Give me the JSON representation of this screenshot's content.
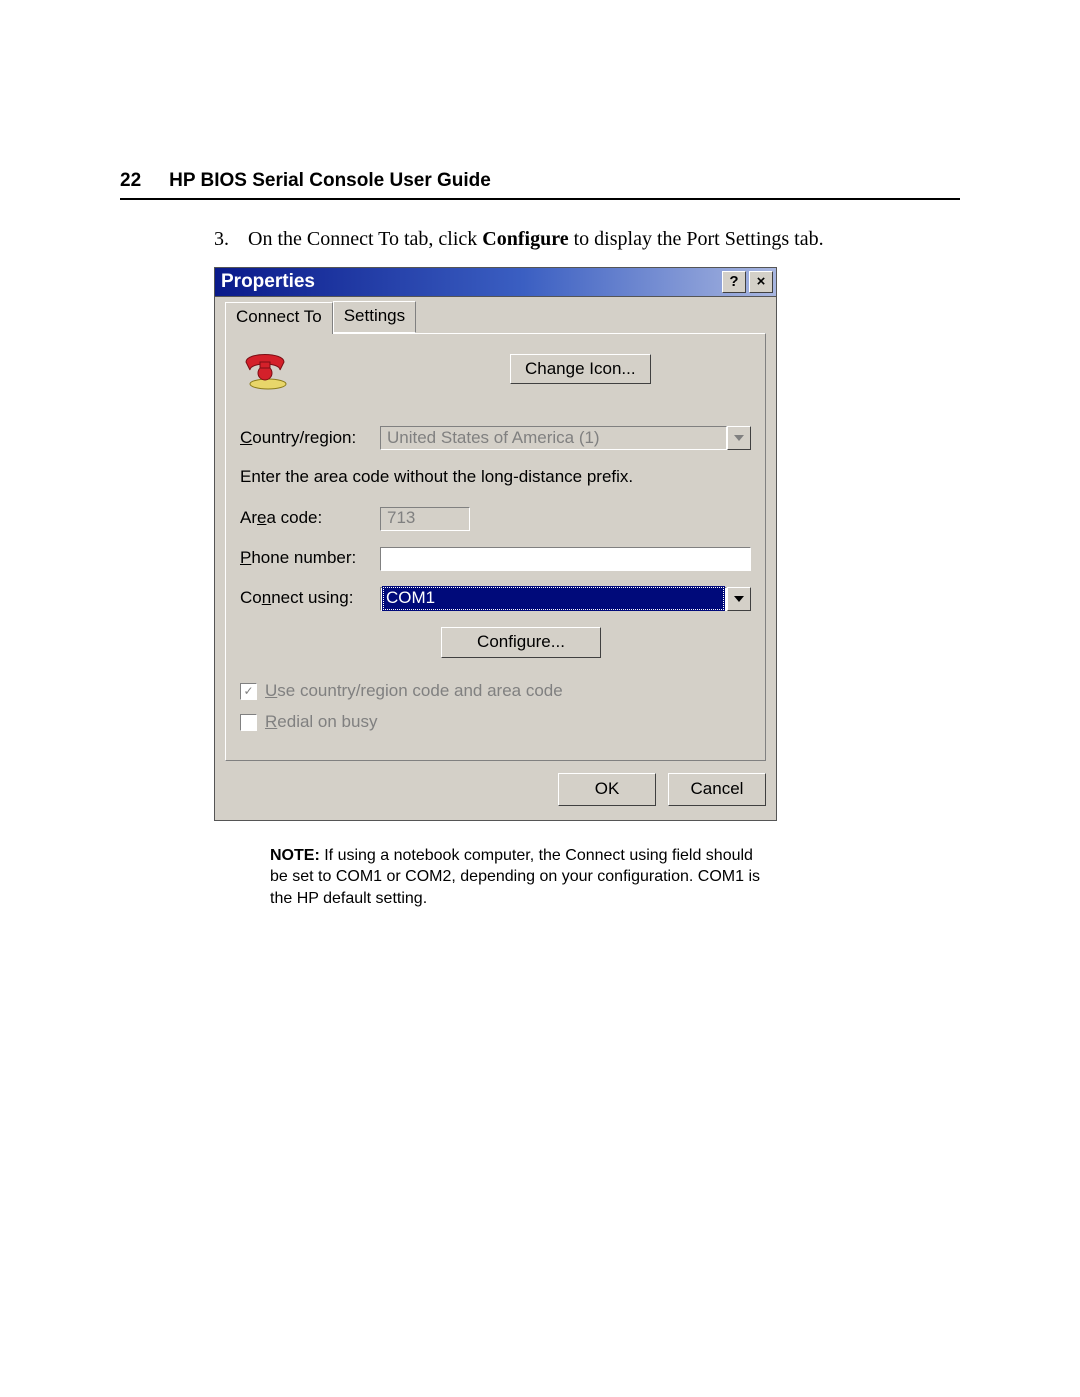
{
  "header": {
    "page_number": "22",
    "title": "HP BIOS Serial Console User Guide"
  },
  "step": {
    "number": "3.",
    "text_before": "On the Connect To tab, click ",
    "bold_word": "Configure",
    "text_after": " to display the Port Settings tab."
  },
  "dialog": {
    "title": "Properties",
    "help_btn": "?",
    "close_btn": "×",
    "tabs": {
      "active": "Connect To",
      "inactive": "Settings"
    },
    "change_icon_btn": "Change Icon...",
    "country_label_pre": "C",
    "country_label_rest": "ountry/region:",
    "country_value": "United States of America (1)",
    "hint": "Enter the area code without the long-distance prefix.",
    "area_label_pre": "Ar",
    "area_label_acc": "e",
    "area_label_post": "a code:",
    "area_value": "713",
    "phone_label_acc": "P",
    "phone_label_rest": "hone number:",
    "phone_value": "",
    "connect_label_pre": "Co",
    "connect_label_acc": "n",
    "connect_label_post": "nect using:",
    "connect_value": "COM1",
    "configure_btn": "Configure...",
    "chk1_acc": "U",
    "chk1_rest": "se country/region code and area code",
    "chk2_acc": "R",
    "chk2_rest": "edial on busy",
    "ok_btn": "OK",
    "cancel_btn": "Cancel"
  },
  "note": {
    "label": "NOTE:",
    "text": "  If using a notebook computer, the Connect using field should be set to COM1 or COM2, depending on your configuration. COM1 is the HP default setting."
  }
}
